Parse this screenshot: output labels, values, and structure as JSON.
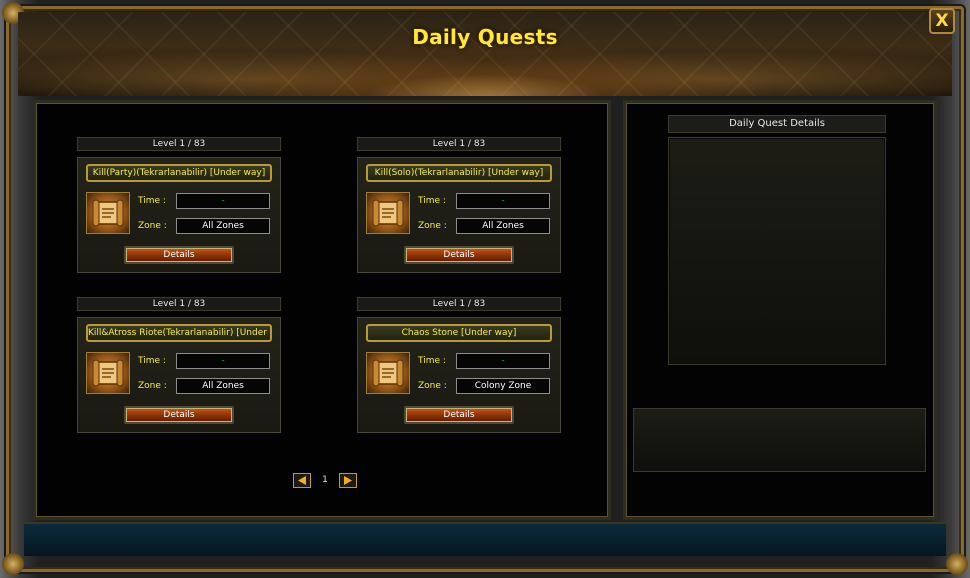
{
  "window": {
    "title": "Daily Quests",
    "close_label": "X"
  },
  "quests": [
    {
      "level": "Level  1 / 83",
      "name": "Kill(Party)(Tekrarlanabilir) [Under way]",
      "time_label": "Time :",
      "time_value": "-",
      "zone_label": "Zone :",
      "zone_value": "All Zones",
      "details_label": "Details"
    },
    {
      "level": "Level  1 / 83",
      "name": "Kill(Solo)(Tekrarlanabilir) [Under way]",
      "time_label": "Time :",
      "time_value": "-",
      "zone_label": "Zone :",
      "zone_value": "All Zones",
      "details_label": "Details"
    },
    {
      "level": "Level  1 / 83",
      "name": "Kill&Atross Riote(Tekrarlanabilir) [Under wa",
      "time_label": "Time :",
      "time_value": "-",
      "zone_label": "Zone :",
      "zone_value": "All Zones",
      "details_label": "Details"
    },
    {
      "level": "Level  1 / 83",
      "name": "Chaos Stone [Under way]",
      "time_label": "Time :",
      "time_value": "-",
      "zone_label": "Zone :",
      "zone_value": "Colony Zone",
      "details_label": "Details"
    }
  ],
  "pagination": {
    "current_page": "1"
  },
  "details_panel": {
    "title": "Daily Quest Details"
  },
  "icons": {
    "close": "close-icon",
    "quest": "scroll-icon",
    "prev": "arrow-left-icon",
    "next": "arrow-right-icon"
  },
  "colors": {
    "accent": "#ffe83a",
    "label": "#f2ec58",
    "timer": "#3cbc3c",
    "button": "#c8591a"
  }
}
